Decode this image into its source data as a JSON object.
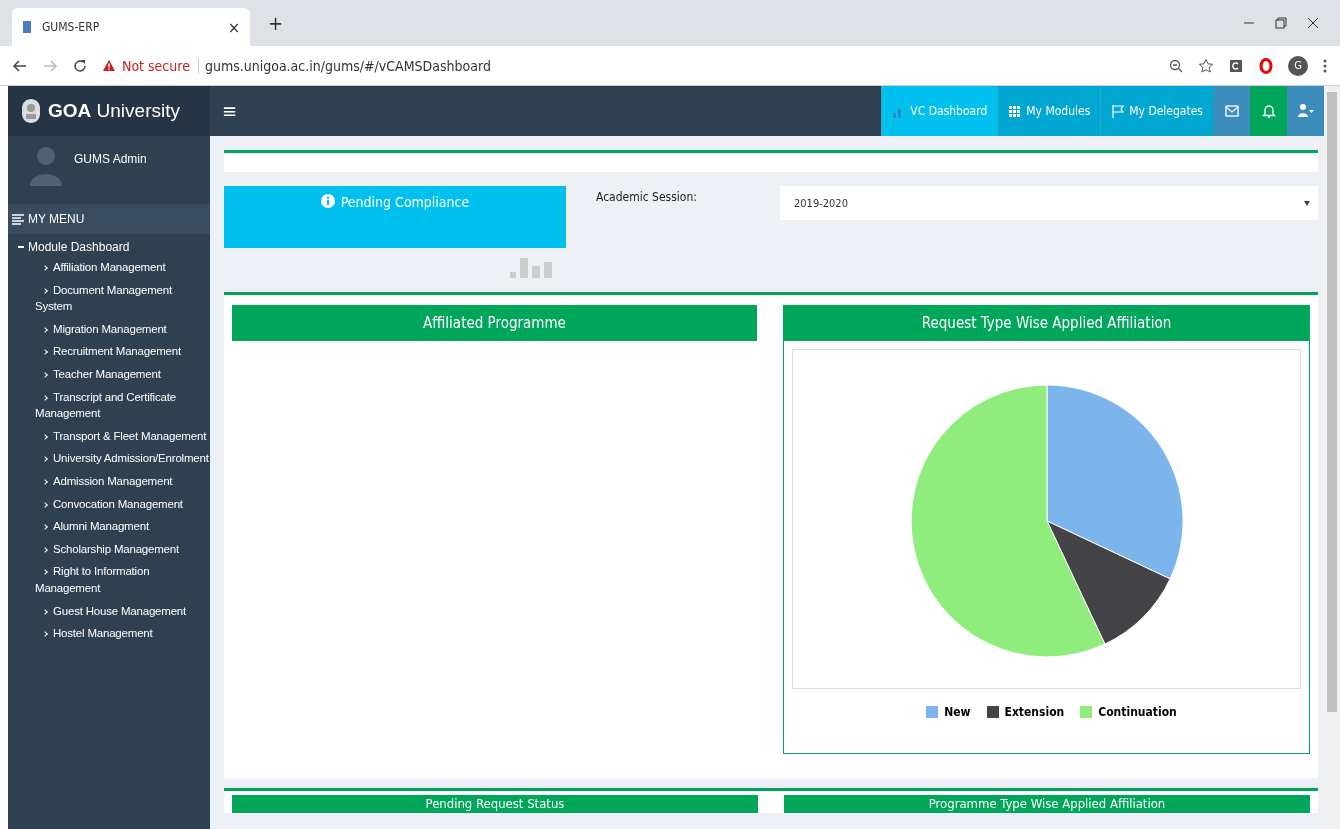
{
  "browser": {
    "tab_title": "GUMS-ERP",
    "tab_close": "×",
    "new_tab": "+",
    "security": "Not secure",
    "url": "gums.unigoa.ac.in/gums/#/vCAMSDashboard",
    "profile_initial": "G"
  },
  "header": {
    "brand_bold": "GOA",
    "brand": "University",
    "menu_glyph": "≡",
    "nav": [
      {
        "label": "VC Dashboard",
        "kind": "dashboard",
        "selected": true
      },
      {
        "label": "My Modules",
        "kind": "modules",
        "selected": false
      },
      {
        "label": "My Delegates",
        "kind": "delegates",
        "selected": false
      }
    ],
    "icons": [
      {
        "kind": "mail"
      },
      {
        "kind": "bell"
      },
      {
        "kind": "user"
      }
    ]
  },
  "sidebar": {
    "user": "GUMS Admin",
    "menu_title": "MY MENU",
    "items": [
      {
        "label": "Module Dashboard",
        "expanded": true,
        "children": [
          {
            "label": "Affiliation Management"
          },
          {
            "label": "Document Management System"
          },
          {
            "label": "Migration Management"
          },
          {
            "label": "Recruitment Management"
          },
          {
            "label": "Teacher Management"
          },
          {
            "label": "Transcript and Certificate Management"
          },
          {
            "label": "Transport & Fleet Management"
          },
          {
            "label": "University Admission/Enrolment"
          },
          {
            "label": "Admission Management"
          },
          {
            "label": "Convocation Management"
          },
          {
            "label": "Alumni Managment"
          },
          {
            "label": "Scholarship Management"
          },
          {
            "label": "Right to Information Management"
          },
          {
            "label": "Guest House Management"
          },
          {
            "label": "Hostel Management"
          }
        ]
      }
    ]
  },
  "filters": {
    "pending_button": "Pending Compliance",
    "session_label": "Academic Session:",
    "session_value": "2019-2020"
  },
  "panels": [
    {
      "title": "Affiliated Programme"
    },
    {
      "title": "Request Type Wise Applied Affiliation",
      "legend": [
        {
          "label": "New",
          "color": "#7cb5ec"
        },
        {
          "label": "Extension",
          "color": "#434348"
        },
        {
          "label": "Continuation",
          "color": "#90ed7d"
        }
      ]
    }
  ],
  "lower_panels": [
    {
      "title": "Pending Request Status"
    },
    {
      "title": "Programme Type Wise Applied Affiliation"
    }
  ]
}
